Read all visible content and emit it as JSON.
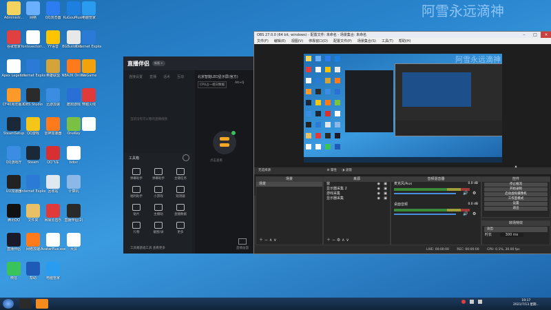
{
  "watermark_main": "阿雪永远滴神",
  "watermark_obs": "阿雪永远滴神",
  "desktop_icons": [
    {
      "label": "Administr...",
      "color": "#f4d35e"
    },
    {
      "label": "网络",
      "color": "#6ab0ff"
    },
    {
      "label": "QQ浏览器",
      "color": "#2e7df0"
    },
    {
      "label": "KuGouMusic",
      "color": "#1d7fe0"
    },
    {
      "label": "电脑管家",
      "color": "#2a9cf0"
    },
    {
      "label": "谷歌管家",
      "color": "#e04040"
    },
    {
      "label": "fontsvectorr...",
      "color": "#ffffff"
    },
    {
      "label": "YY语音",
      "color": "#ffc400"
    },
    {
      "label": "BGBuildOrb...",
      "color": "#e8e8e8"
    },
    {
      "label": "Internet Explorer",
      "color": "#2b7bd6"
    },
    {
      "label": "Apex Legends",
      "color": "#ffffff"
    },
    {
      "label": "Internet Explorer",
      "color": "#2b7bd6"
    },
    {
      "label": "英雄联盟",
      "color": "#d4a33a"
    },
    {
      "label": "NBA2K Online",
      "color": "#ff7a1a"
    },
    {
      "label": "WeGame",
      "color": "#f2a20c"
    },
    {
      "label": "CF40周年版本",
      "color": "#ff9a2a"
    },
    {
      "label": "OBS Studio",
      "color": "#2b2b2b"
    },
    {
      "label": "迅游加速",
      "color": "#3a8de0"
    },
    {
      "label": "酷狗游戏",
      "color": "#2a6fd6"
    },
    {
      "label": "穿越火线",
      "color": "#e03a3a"
    },
    {
      "label": "SteamSetup",
      "color": "#1b2838"
    },
    {
      "label": "QQ游戏",
      "color": "#f5c518"
    },
    {
      "label": "雷神加速器",
      "color": "#ff7a1a"
    },
    {
      "label": "OneKey",
      "color": "#7ac143"
    },
    {
      "label": "",
      "color": "#ffffff"
    },
    {
      "label": "QQ游戏厅",
      "color": "#3a8de0"
    },
    {
      "label": "Steam",
      "color": "#1b2838"
    },
    {
      "label": "QQ飞车",
      "color": "#d83030"
    },
    {
      "label": "bdoc",
      "color": "#ffffff"
    },
    {
      "label": "网易云音乐",
      "color": "#d8303a"
    },
    {
      "label": "UU加速器",
      "color": "#222222"
    },
    {
      "label": "Internet Explorer",
      "color": "#2b7bd6"
    },
    {
      "label": "回收站",
      "color": "#dfe8f0"
    },
    {
      "label": "计算机",
      "color": "#8cb8e8"
    },
    {
      "label": "腾讯QQ",
      "color": "#111111"
    },
    {
      "label": "文件夹",
      "color": "#e9c066"
    },
    {
      "label": "网易云音乐",
      "color": "#e03a3a"
    },
    {
      "label": "直播伴侣(2)",
      "color": "#2a2a2a"
    },
    {
      "label": "直播伴侣",
      "color": "#1a1a2a"
    },
    {
      "label": "网络加速",
      "color": "#ff7a1a"
    },
    {
      "label": "AvatarPlus.exe",
      "color": "#ffffff"
    },
    {
      "label": "大屏",
      "color": "#ffffff"
    },
    {
      "label": "微信",
      "color": "#3ac35a"
    },
    {
      "label": "帮助",
      "color": "#1e5ab8"
    },
    {
      "label": "电脑管家",
      "color": "#2a9cf0"
    }
  ],
  "assist": {
    "title": "直播伴侣",
    "badge": "新版 +",
    "tabs": [
      "连接设置",
      "直播",
      "话术",
      "互动"
    ],
    "headline": "北京智能LED显示屏(官方)",
    "pill1": "CPU占一组日数据",
    "pill2": "Alt+Q",
    "empty": "当前没有可以看的直播视频",
    "tools_title": "工具箱",
    "tools": [
      "弹幕助手",
      "弹幕助手",
      "主播任务",
      "福利助手",
      "小游戏",
      "观测器",
      "贴片",
      "主播助",
      "直播数据",
      "礼物",
      "截图/录",
      "更多"
    ],
    "bottom_note": "工具箱基础工具 查看更多",
    "pane_caption": "直播画面",
    "status": "点击查看"
  },
  "obs": {
    "title": "OBS 27.0.0 (64 bit, windows) - 配置文件: 未命名 - 场景集合: 未命名",
    "menu": [
      "文件(F)",
      "编辑(E)",
      "视图(V)",
      "停靠窗口(D)",
      "配置文件(P)",
      "场景集合(S)",
      "工具(T)",
      "帮助(H)"
    ],
    "bar_left": "无选择源",
    "bar_props": "属性",
    "bar_filters": "滤镜",
    "docks": {
      "scenes": {
        "title": "场景",
        "items": [
          "场景"
        ]
      },
      "sources": {
        "title": "来源",
        "items": [
          "窗",
          "显示器采集 2",
          "游戏采集",
          "显示器采集"
        ]
      },
      "mixer": {
        "title": "音频混音器",
        "tracks": [
          {
            "name": "麦克风/Aux",
            "level": "0.0 dB"
          },
          {
            "name": "桌面音频",
            "level": "0.0 dB"
          }
        ]
      },
      "controls": {
        "title": "控件",
        "buttons": [
          "停止推流",
          "开始录制",
          "启动虚拟摄像机",
          "工作室模式",
          "设置",
          "退出"
        ]
      }
    },
    "transitions": {
      "title": "转场特效",
      "fade": "淡出",
      "duration_label": "时长",
      "duration": "300 ms"
    },
    "status": {
      "live": "LIVE: 00:00:00",
      "rec": "REC: 00:00:00",
      "cpu": "CPU: 0.1%, 30.00 fps"
    }
  },
  "taskbar": {
    "clock_time": "19:17",
    "clock_date": "2021/7/13 星期..."
  }
}
